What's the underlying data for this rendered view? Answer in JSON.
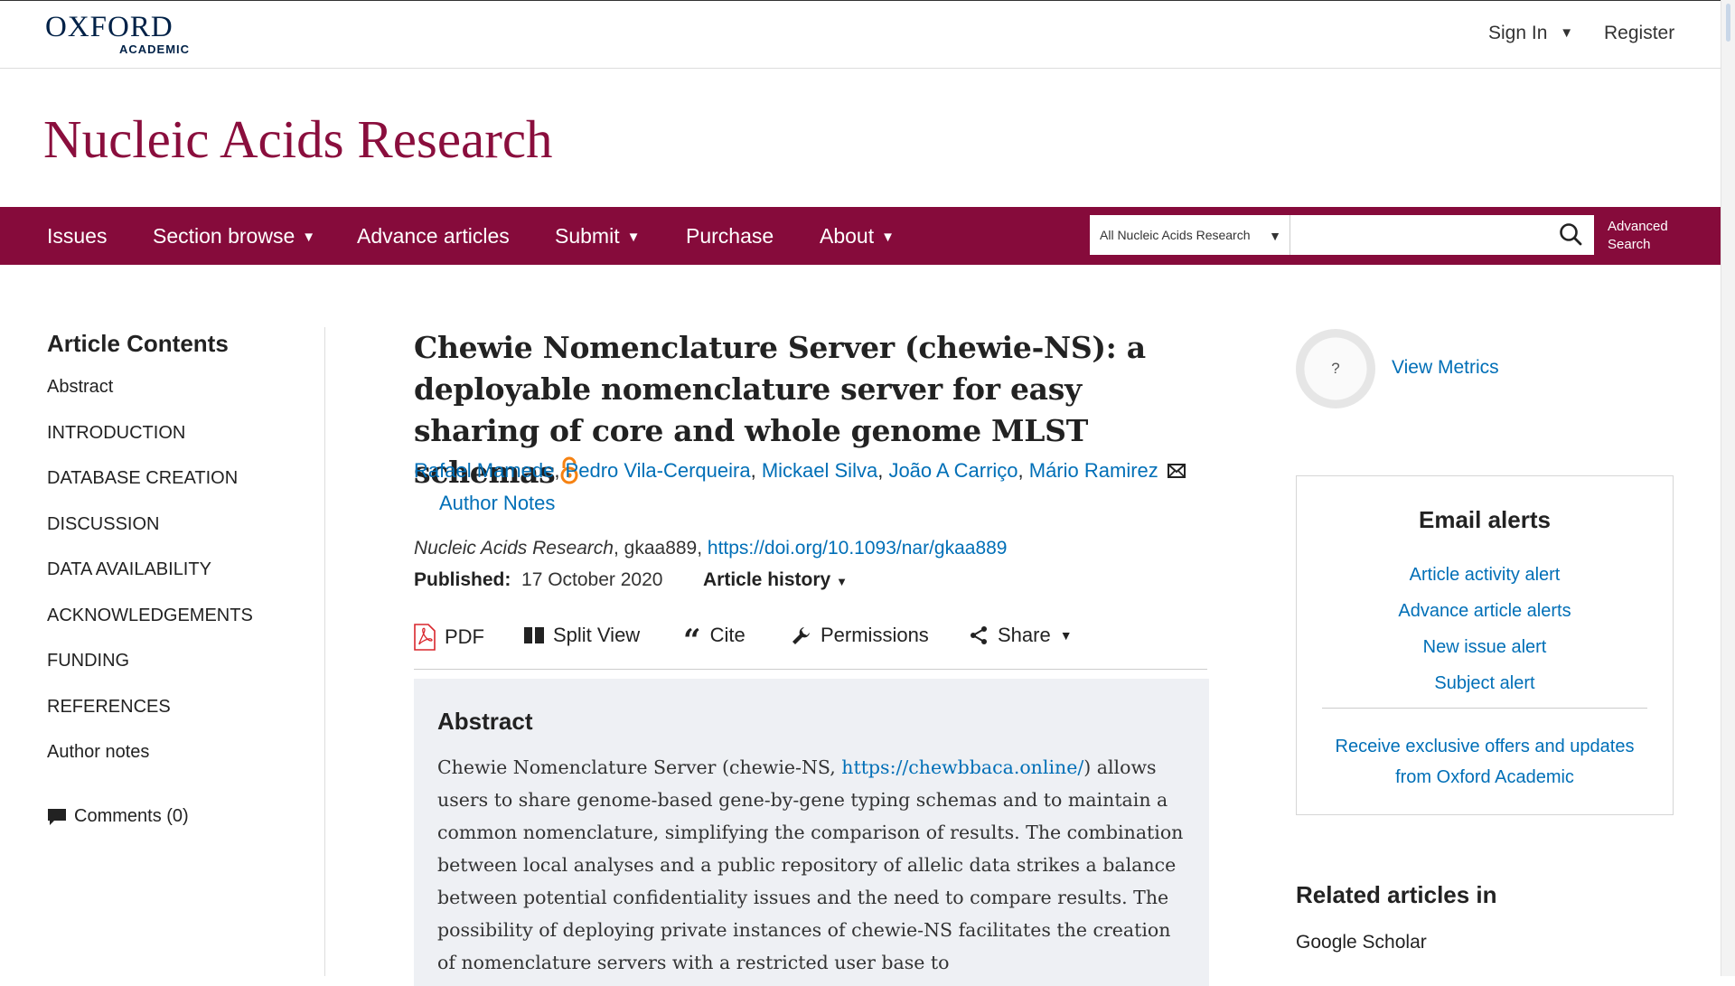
{
  "header": {
    "logo_line1": "OXFORD",
    "logo_line2": "ACADEMIC",
    "sign_in": "Sign In",
    "register": "Register"
  },
  "journal": {
    "title": "Nucleic Acids Research"
  },
  "nav": {
    "items": [
      "Issues",
      "Section browse",
      "Advance articles",
      "Submit",
      "Purchase",
      "About"
    ],
    "search_scope": "All Nucleic Acids Research",
    "search_value": "",
    "advanced_search_line1": "Advanced",
    "advanced_search_line2": "Search"
  },
  "sidebar": {
    "title": "Article Contents",
    "items": [
      "Abstract",
      "INTRODUCTION",
      "DATABASE CREATION",
      "DISCUSSION",
      "DATA AVAILABILITY",
      "ACKNOWLEDGEMENTS",
      "FUNDING",
      "REFERENCES",
      "Author notes"
    ],
    "comments": "Comments (0)"
  },
  "article": {
    "title": "Chewie Nomenclature Server (chewie-NS): a deployable nomenclature server for easy sharing of core and whole genome MLST schemas",
    "authors": [
      "Rafael Mamede",
      "Pedro Vila-Cerqueira",
      "Mickael Silva",
      "João A Carriço",
      "Mário Ramirez"
    ],
    "author_notes": "Author Notes",
    "journal_name": "Nucleic Acids Research",
    "article_id": ", gkaa889, ",
    "doi": "https://doi.org/10.1093/nar/gkaa889",
    "published_label": "Published:",
    "published_date": "17 October 2020",
    "article_history": "Article history",
    "tools": {
      "pdf": "PDF",
      "split_view": "Split View",
      "cite": "Cite",
      "permissions": "Permissions",
      "share": "Share"
    },
    "abstract": {
      "heading": "Abstract",
      "text_before_link": "Chewie Nomenclature Server (chewie-NS, ",
      "link": "https://chewbbaca.online/",
      "text_after_link": ") allows users to share genome-based gene-by-gene typing schemas and to maintain a common nomenclature, simplifying the comparison of results. The combination between local analyses and a public repository of allelic data strikes a balance between potential confidentiality issues and the need to compare results. The possibility of deploying private instances of chewie-NS facilitates the creation of nomenclature servers with a restricted user base to"
    }
  },
  "right": {
    "metrics_badge": "?",
    "view_metrics": "View Metrics",
    "email_alerts": {
      "title": "Email alerts",
      "links": [
        "Article activity alert",
        "Advance article alerts",
        "New issue alert",
        "Subject alert"
      ],
      "offers_line1": "Receive exclusive offers and updates",
      "offers_line2": "from Oxford Academic"
    },
    "related_title": "Related articles in",
    "google_scholar": "Google Scholar"
  },
  "colors": {
    "brand": "#860b3b",
    "journal_title": "#8a0e3d",
    "link": "#006fb7",
    "abstract_bg": "#eef0f4",
    "oa_icon": "#f68212",
    "pdf_icon": "#d9262c"
  }
}
